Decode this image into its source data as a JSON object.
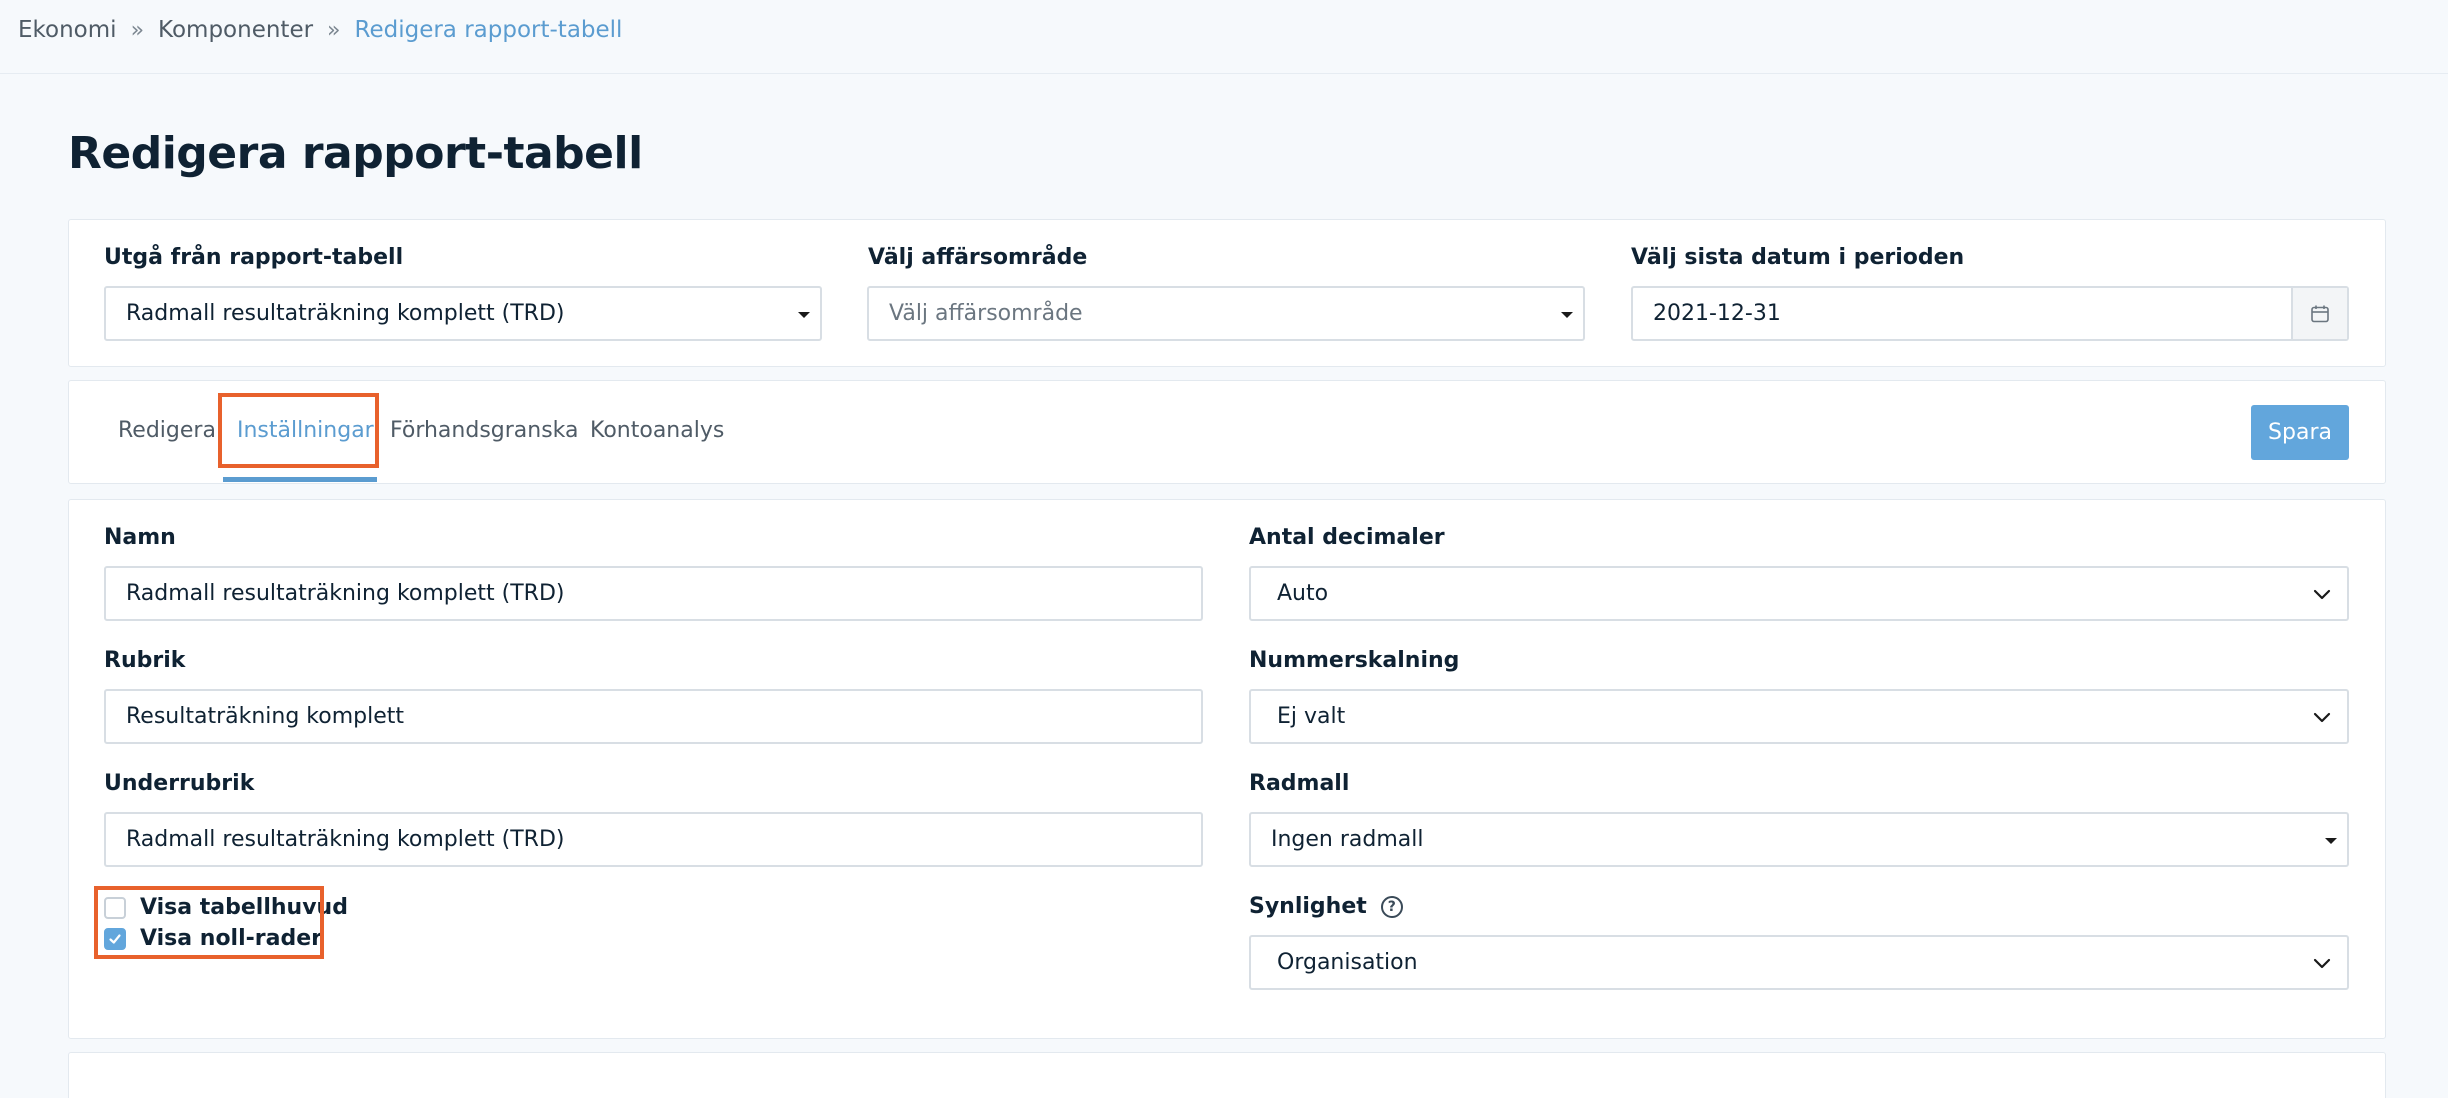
{
  "breadcrumb": {
    "items": [
      "Ekonomi",
      "Komponenter",
      "Redigera rapport-tabell"
    ]
  },
  "page_title": "Redigera rapport-tabell",
  "filters": {
    "source_label": "Utgå från rapport-tabell",
    "source_value": "Radmall resultaträkning komplett (TRD)",
    "area_label": "Välj affärsområde",
    "area_placeholder": "Välj affärsområde",
    "date_label": "Välj sista datum i perioden",
    "date_value": "2021-12-31",
    "date_icon": "calendar-icon"
  },
  "tabs": [
    {
      "label": "Redigera",
      "active": false
    },
    {
      "label": "Inställningar",
      "active": true
    },
    {
      "label": "Förhandsgranska",
      "active": false
    },
    {
      "label": "Kontoanalys",
      "active": false
    }
  ],
  "save_label": "Spara",
  "settings": {
    "name_label": "Namn",
    "name_value": "Radmall resultaträkning komplett (TRD)",
    "heading_label": "Rubrik",
    "heading_value": "Resultaträkning komplett",
    "subheading_label": "Underrubrik",
    "subheading_value": "Radmall resultaträkning komplett (TRD)",
    "decimals_label": "Antal decimaler",
    "decimals_value": "Auto",
    "scaling_label": "Nummerskalning",
    "scaling_value": "Ej valt",
    "template_label": "Radmall",
    "template_value": "Ingen radmall",
    "visibility_label": "Synlighet",
    "visibility_value": "Organisation",
    "show_header_label": "Visa tabellhuvud",
    "show_header_checked": false,
    "show_zero_label": "Visa noll-rader",
    "show_zero_checked": true
  },
  "colors": {
    "accent": "#5b9cd0",
    "button": "#62a6dc",
    "highlight": "#e8612c",
    "title": "#0f2233"
  }
}
